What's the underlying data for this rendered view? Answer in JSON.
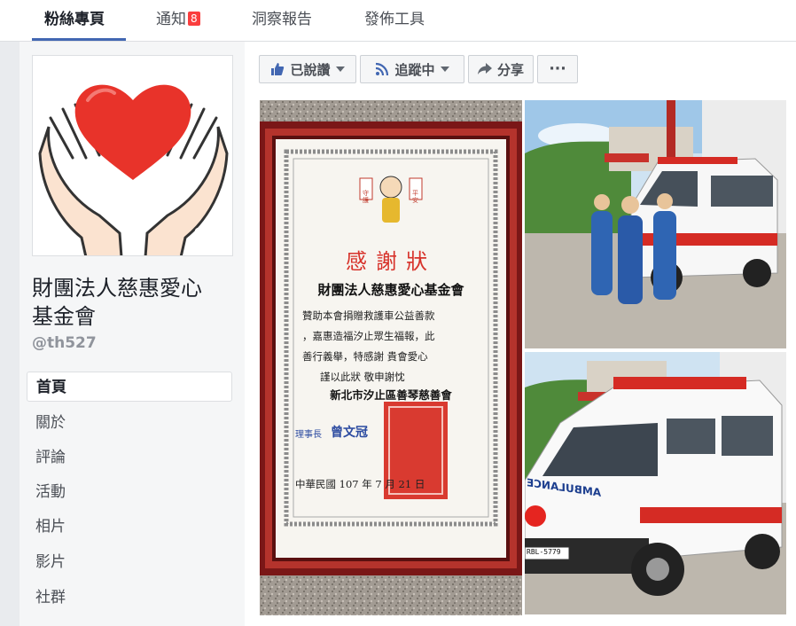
{
  "tabs": [
    {
      "label": "粉絲專頁"
    },
    {
      "label": "通知",
      "badge": "8"
    },
    {
      "label": "洞察報告"
    },
    {
      "label": "發佈工具"
    }
  ],
  "page": {
    "name_line1": "財團法人慈惠愛心",
    "name_line2": "基金會",
    "handle": "@th527"
  },
  "nav": [
    {
      "label": "首頁"
    },
    {
      "label": "關於"
    },
    {
      "label": "評論"
    },
    {
      "label": "活動"
    },
    {
      "label": "相片"
    },
    {
      "label": "影片"
    },
    {
      "label": "社群"
    }
  ],
  "actions": {
    "liked": "已說讚",
    "following": "追蹤中",
    "share": "分享",
    "more": "···"
  },
  "certificate": {
    "badge_left": "守護",
    "badge_right": "平安",
    "title": "感謝狀",
    "recipient": "財團法人慈惠愛心基金會",
    "body_line1": "贊助本會捐贈救護車公益善款",
    "body_line2": "，嘉惠造福汐止眾生福報，此",
    "body_line3": "善行義舉，特感謝 貴會愛心",
    "body_line4": "謹以此狀 敬申謝忱",
    "issuer": "新北市汐止區善琴慈善會",
    "chairman_title": "理事長",
    "chairman_name": "曾文冠",
    "date": "中華民國 107 年 7 月 21 日"
  },
  "ambulance": {
    "plate": "RBL-5779",
    "side_text": "AMBULANCE"
  },
  "colors": {
    "facebook_blue": "#4267b2",
    "badge_red": "#fa3e3e",
    "heart_red": "#e8332a",
    "frame_red": "#8b1a1a"
  }
}
